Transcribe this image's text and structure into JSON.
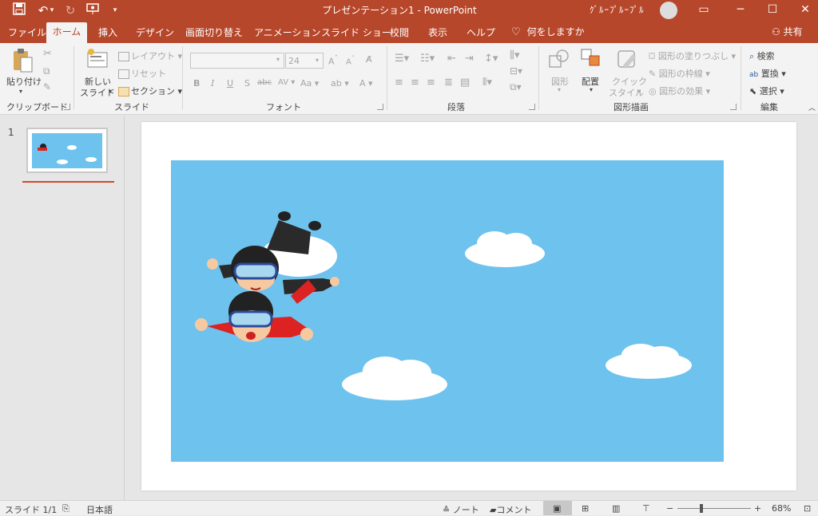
{
  "window": {
    "title": "プレゼンテーション1  -  PowerPoint",
    "user_name": "ｸﾞﾙｰﾌﾟﾙｰﾌﾟﾙ"
  },
  "tabs": [
    "ファイル",
    "ホーム",
    "挿入",
    "デザイン",
    "画面切り替え",
    "アニメーション",
    "スライド ショー",
    "校閲",
    "表示",
    "ヘルプ"
  ],
  "tellme": "何をしますか",
  "share": "共有",
  "ribbon": {
    "clipboard": {
      "paste": "貼り付け",
      "label": "クリップボード"
    },
    "slides": {
      "new_slide_line1": "新しい",
      "new_slide_line2": "スライド",
      "layout": "レイアウト",
      "reset": "リセット",
      "section": "セクション",
      "label": "スライド"
    },
    "font": {
      "size": "24",
      "label": "フォント"
    },
    "paragraph": {
      "label": "段落"
    },
    "drawing": {
      "shape": "図形",
      "arrange": "配置",
      "quick_line1": "クイック",
      "quick_line2": "スタイル",
      "fill": "図形の塗りつぶし",
      "outline": "図形の枠線",
      "effect": "図形の効果",
      "label": "図形描画"
    },
    "editing": {
      "find": "検索",
      "replace": "置換",
      "select": "選択",
      "label": "編集"
    }
  },
  "slides_pane": {
    "number": "1"
  },
  "status": {
    "slide": "スライド 1/1",
    "language": "日本語",
    "notes": "ノート",
    "comments": "コメント",
    "zoom": "68%"
  },
  "colors": {
    "accent": "#b7472a",
    "sky": "#6ec2ee"
  }
}
